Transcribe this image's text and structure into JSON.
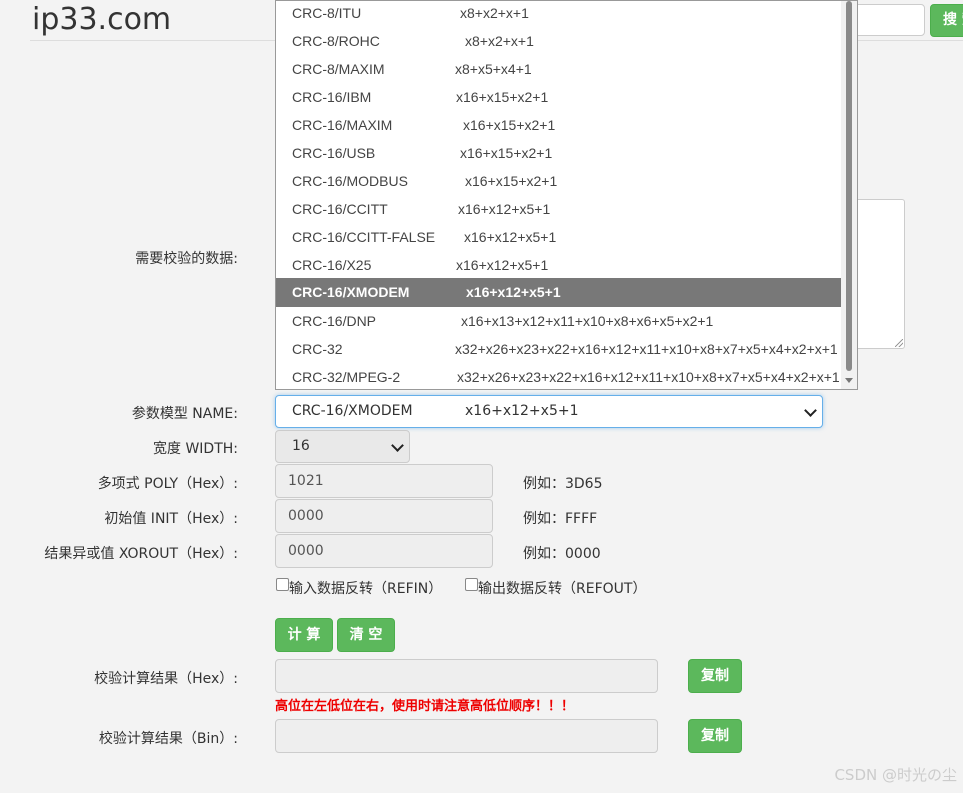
{
  "header": {
    "site_title": "ip33.com",
    "search_button": "搜 索"
  },
  "labels": {
    "data": "需要校验的数据:",
    "name": "参数模型 NAME:",
    "width": "宽度 WIDTH:",
    "poly": "多项式 POLY（Hex）:",
    "init": "初始值 INIT（Hex）:",
    "xorout": "结果异或值 XOROUT（Hex）:",
    "result_hex": "校验计算结果（Hex）:",
    "result_bin": "校验计算结果（Bin）:"
  },
  "form": {
    "name_selected": {
      "name": "CRC-16/XMODEM",
      "poly": "x16+x12+x5+1"
    },
    "width_value": "16",
    "poly_value": "1021",
    "init_value": "0000",
    "xorout_value": "0000",
    "poly_hint": "例如：3D65",
    "init_hint": "例如：FFFF",
    "xorout_hint": "例如：0000",
    "refin_label": "输入数据反转（REFIN）",
    "refout_label": "输出数据反转（REFOUT）",
    "calc_button": "计 算",
    "clear_button": "清 空",
    "copy_label": "复制",
    "warning": "高位在左低位在右，使用时请注意高低位顺序！！！"
  },
  "dropdown": {
    "options": [
      {
        "name": "CRC-8/ITU",
        "poly": "x8+x2+x+1"
      },
      {
        "name": "CRC-8/ROHC",
        "poly": "x8+x2+x+1"
      },
      {
        "name": "CRC-8/MAXIM",
        "poly": "x8+x5+x4+1"
      },
      {
        "name": "CRC-16/IBM",
        "poly": "x16+x15+x2+1"
      },
      {
        "name": "CRC-16/MAXIM",
        "poly": "x16+x15+x2+1"
      },
      {
        "name": "CRC-16/USB",
        "poly": "x16+x15+x2+1"
      },
      {
        "name": "CRC-16/MODBUS",
        "poly": "x16+x15+x2+1"
      },
      {
        "name": "CRC-16/CCITT",
        "poly": "x16+x12+x5+1"
      },
      {
        "name": "CRC-16/CCITT-FALSE",
        "poly": "x16+x12+x5+1"
      },
      {
        "name": "CRC-16/X25",
        "poly": "x16+x12+x5+1"
      },
      {
        "name": "CRC-16/XMODEM",
        "poly": "x16+x12+x5+1"
      },
      {
        "name": "CRC-16/DNP",
        "poly": "x16+x13+x12+x11+x10+x8+x6+x5+x2+1"
      },
      {
        "name": "CRC-32",
        "poly": "x32+x26+x23+x22+x16+x12+x11+x10+x8+x7+x5+x4+x2+x+1"
      },
      {
        "name": "CRC-32/MPEG-2",
        "poly": "x32+x26+x23+x22+x16+x12+x11+x10+x8+x7+x5+x4+x2+x+1"
      }
    ],
    "selected_index": 10
  },
  "watermark": "CSDN @时光の尘",
  "colors": {
    "button_green": "#5cb85c",
    "selected_option_bg": "#787878",
    "warning_red": "#e00000"
  }
}
